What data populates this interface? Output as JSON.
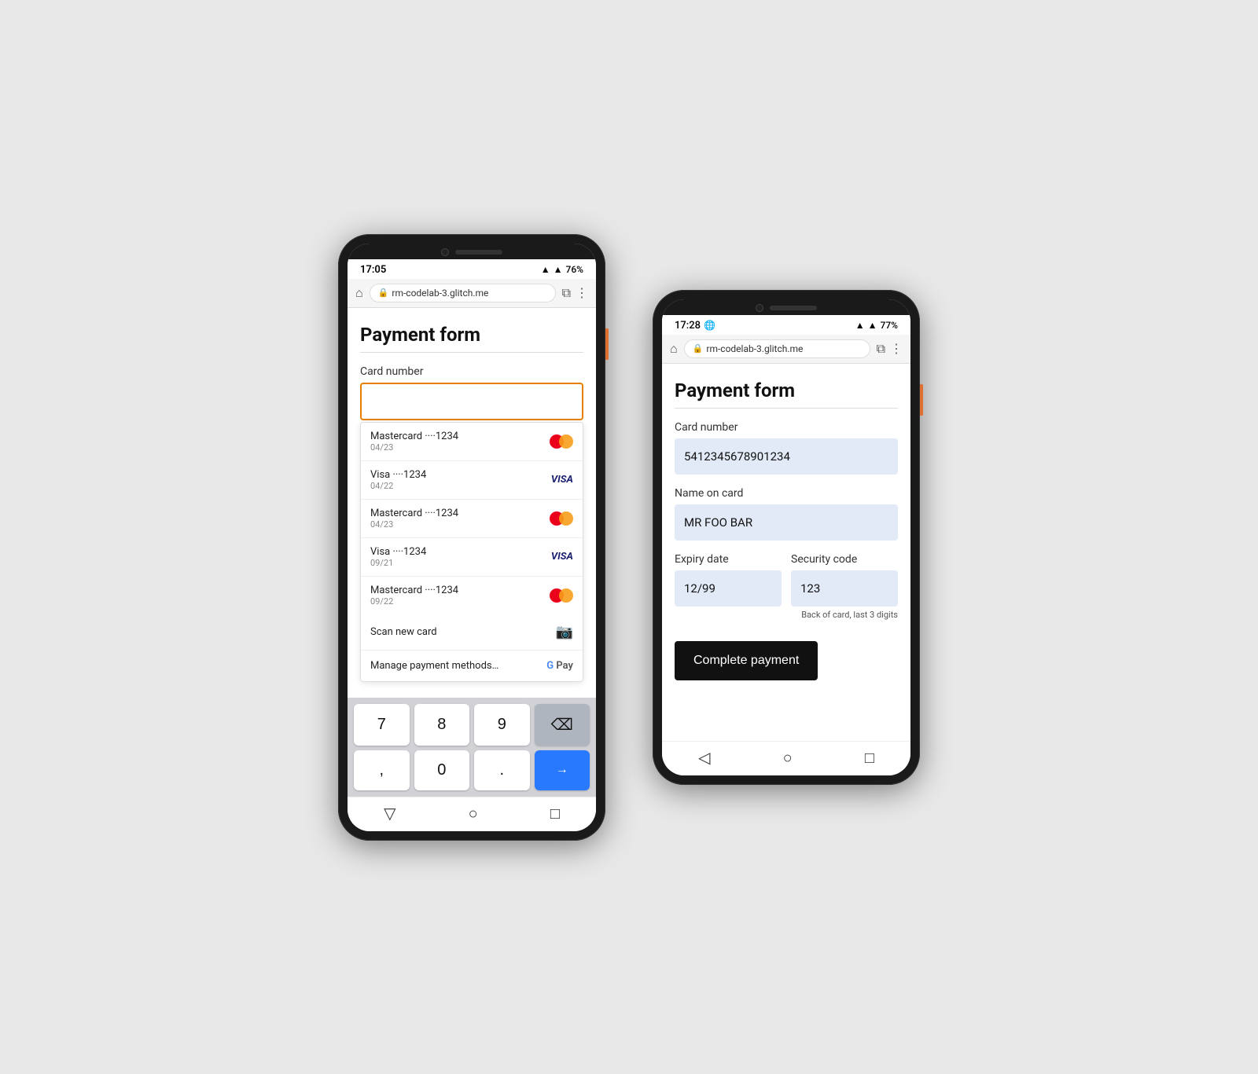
{
  "left_phone": {
    "status": {
      "time": "17:05",
      "battery": "76%",
      "signal": "▲"
    },
    "browser": {
      "url": "rm-codelab-3.glitch.me"
    },
    "page": {
      "title": "Payment form",
      "card_number_label": "Card number",
      "cards": [
        {
          "brand": "Mastercard",
          "last4": "1234",
          "expiry": "04/23",
          "type": "mastercard"
        },
        {
          "brand": "Visa",
          "last4": "1234",
          "expiry": "04/22",
          "type": "visa"
        },
        {
          "brand": "Mastercard",
          "last4": "1234",
          "expiry": "04/23",
          "type": "mastercard"
        },
        {
          "brand": "Visa",
          "last4": "1234",
          "expiry": "09/21",
          "type": "visa"
        },
        {
          "brand": "Mastercard",
          "last4": "1234",
          "expiry": "09/22",
          "type": "mastercard"
        }
      ],
      "scan_label": "Scan new card",
      "manage_label": "Manage payment methods…"
    },
    "keyboard": {
      "keys": [
        "7",
        "8",
        "9",
        "⌫",
        ",",
        "0",
        ".",
        "→"
      ]
    }
  },
  "right_phone": {
    "status": {
      "time": "17:28",
      "battery": "77%"
    },
    "browser": {
      "url": "rm-codelab-3.glitch.me"
    },
    "page": {
      "title": "Payment form",
      "card_number_label": "Card number",
      "card_number_value": "5412345678901234",
      "name_label": "Name on card",
      "name_value": "MR FOO BAR",
      "expiry_label": "Expiry date",
      "expiry_value": "12/99",
      "security_label": "Security code",
      "security_value": "123",
      "security_hint": "Back of card, last 3 digits",
      "submit_label": "Complete payment"
    }
  }
}
